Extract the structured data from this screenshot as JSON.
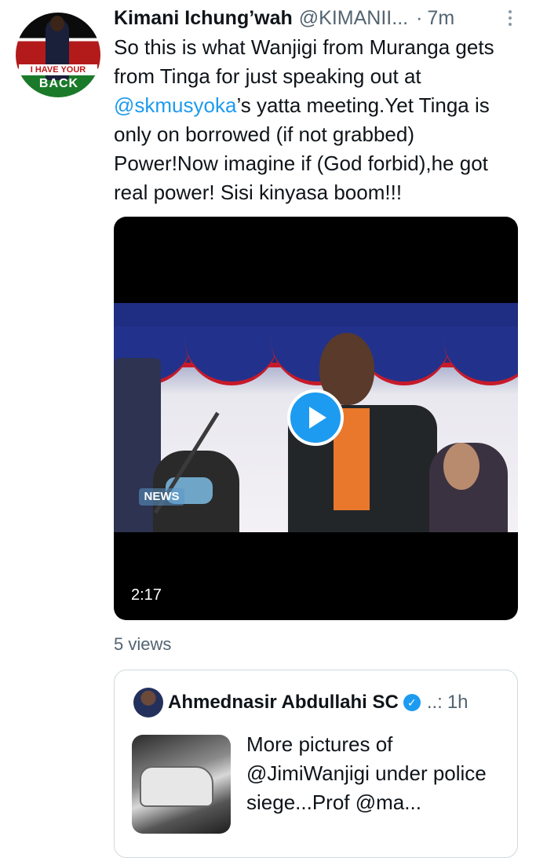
{
  "tweet": {
    "author_name": "Kimani Ichung’wah",
    "author_handle": "@KIMANII...",
    "separator": "·",
    "time": "7m",
    "avatar_banner": "I HAVE YOUR",
    "avatar_banner2": "BACK",
    "text_part1": "So this is what Wanjigi from Muranga gets from Tinga for just speaking out at ",
    "mention": "@skmusyoka",
    "text_part2": "’s yatta meeting.Yet Tinga is only on borrowed (if not grabbed) Power!Now imagine if (God forbid),he got real power! Sisi kinyasa boom!!!",
    "more_icon": "more-vertical-icon"
  },
  "video": {
    "duration": "2:17",
    "watermark": "NEWS",
    "play_icon": "play-icon"
  },
  "views": "5 views",
  "quote": {
    "author_name": "Ahmednasir Abdullahi SC",
    "verified_icon": "verified-icon",
    "handle": "..:",
    "time": "1h",
    "text": "More pictures of @JimiWanjigi under police siege...Prof @ma..."
  },
  "colors": {
    "accent": "#1d9bf0",
    "text": "#0f1419",
    "secondary": "#536471",
    "border": "#cfd9de"
  }
}
